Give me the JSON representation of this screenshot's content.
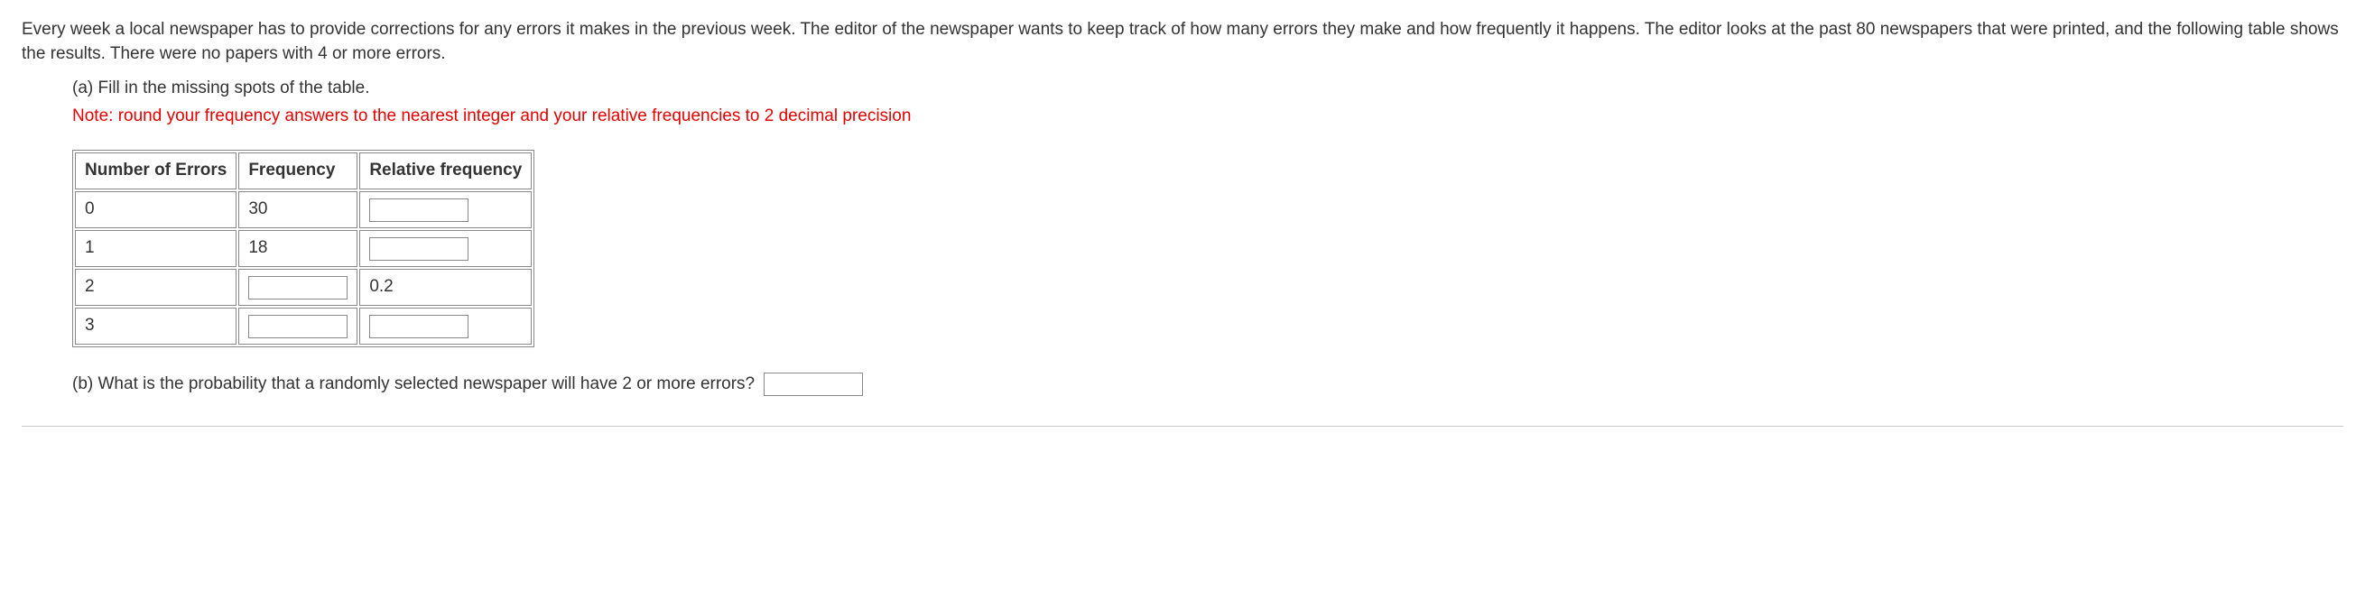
{
  "intro": "Every week a local newspaper has to provide corrections for any errors it makes in the previous week. The editor of the newspaper wants to keep track of how many errors they make and how frequently it happens. The editor looks at the past 80 newspapers that were printed, and the following table shows the results. There were no papers with 4 or more errors.",
  "partA": {
    "label": "(a) Fill in the missing spots of the table.",
    "note": "Note: round your frequency answers to the nearest integer and your relative frequencies to 2 decimal precision"
  },
  "table": {
    "headers": {
      "col1": "Number of Errors",
      "col2": "Frequency",
      "col3": "Relative frequency"
    },
    "rows": [
      {
        "errors": "0",
        "frequency": "30",
        "relative": ""
      },
      {
        "errors": "1",
        "frequency": "18",
        "relative": ""
      },
      {
        "errors": "2",
        "frequency": "",
        "relative": "0.2"
      },
      {
        "errors": "3",
        "frequency": "",
        "relative": ""
      }
    ]
  },
  "partB": {
    "label": "(b) What is the probability that a randomly selected newspaper will have 2 or more errors?"
  }
}
